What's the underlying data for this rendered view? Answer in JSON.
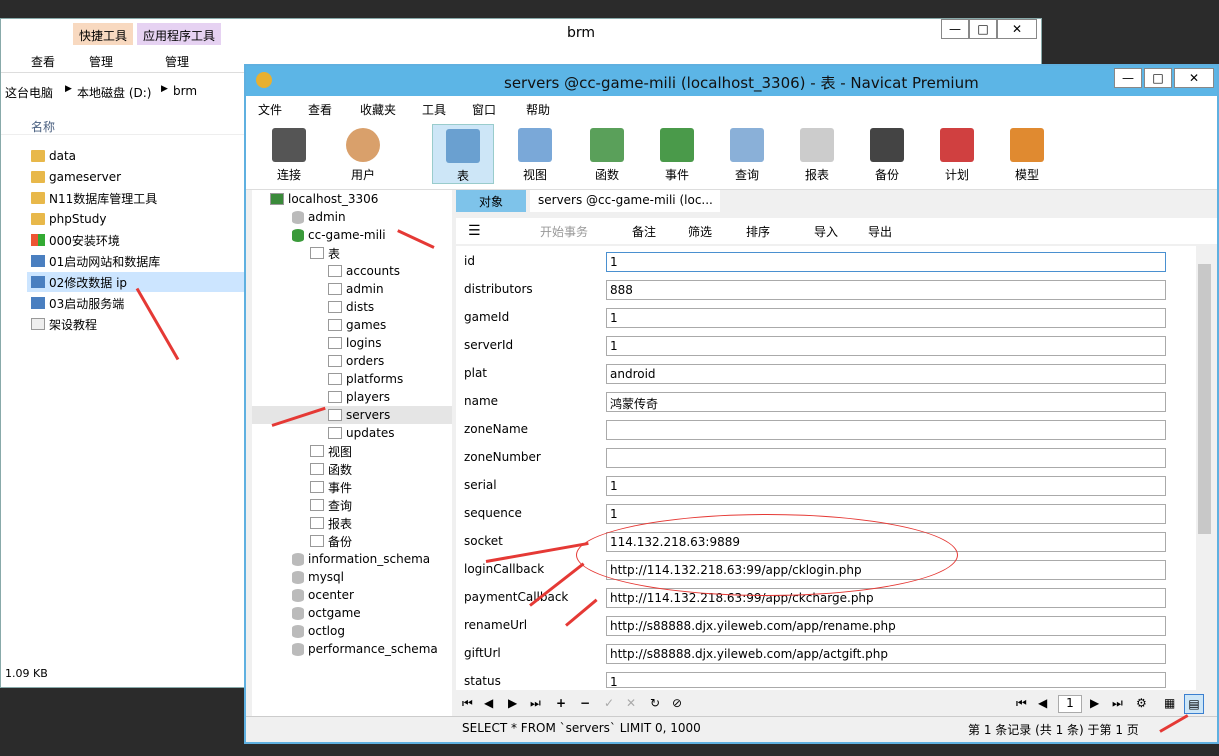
{
  "explorer": {
    "title": "brm",
    "context_tabs": [
      "快捷工具",
      "应用程序工具"
    ],
    "ribbon_tabs": [
      "查看",
      "管理",
      "管理"
    ],
    "breadcrumb": [
      "这台电脑",
      "本地磁盘 (D:)",
      "brm"
    ],
    "column_header": "名称",
    "files": [
      "data",
      "gameserver",
      "N11数据库管理工具",
      "phpStudy",
      "000安装环境",
      "01启动网站和数据库",
      "02修改数据 ip",
      "03启动服务端",
      "架设教程"
    ],
    "status": "1.09 KB"
  },
  "navicat": {
    "title": "servers @cc-game-mili (localhost_3306) - 表 - Navicat Premium",
    "menu": [
      "文件",
      "查看",
      "收藏夹",
      "工具",
      "窗口",
      "帮助"
    ],
    "tools": [
      "连接",
      "用户",
      "表",
      "视图",
      "函数",
      "事件",
      "查询",
      "报表",
      "备份",
      "计划",
      "模型"
    ],
    "tree": {
      "connection": "localhost_3306",
      "databases_top": [
        "admin",
        "cc-game-mili"
      ],
      "table_group": "表",
      "tables": [
        "accounts",
        "admin",
        "dists",
        "games",
        "logins",
        "orders",
        "platforms",
        "players",
        "servers",
        "updates"
      ],
      "groups": [
        "视图",
        "函数",
        "事件",
        "查询",
        "报表",
        "备份"
      ],
      "databases_bottom": [
        "information_schema",
        "mysql",
        "ocenter",
        "octgame",
        "octlog",
        "performance_schema"
      ]
    },
    "tabs": [
      "对象",
      "servers @cc-game-mili (loc..."
    ],
    "form_toolbar": [
      "开始事务",
      "备注",
      "筛选",
      "排序",
      "导入",
      "导出"
    ],
    "fields": [
      {
        "label": "id",
        "value": "1"
      },
      {
        "label": "distributors",
        "value": "888"
      },
      {
        "label": "gameId",
        "value": "1"
      },
      {
        "label": "serverId",
        "value": "1"
      },
      {
        "label": "plat",
        "value": "android"
      },
      {
        "label": "name",
        "value": "鸿蒙传奇"
      },
      {
        "label": "zoneName",
        "value": ""
      },
      {
        "label": "zoneNumber",
        "value": ""
      },
      {
        "label": "serial",
        "value": "1"
      },
      {
        "label": "sequence",
        "value": "1"
      },
      {
        "label": "socket",
        "value": "114.132.218.63:9889"
      },
      {
        "label": "loginCallback",
        "value": "http://114.132.218.63:99/app/cklogin.php"
      },
      {
        "label": "paymentCallback",
        "value": "http://114.132.218.63:99/app/ckcharge.php"
      },
      {
        "label": "renameUrl",
        "value": "http://s88888.djx.yileweb.com/app/rename.php"
      },
      {
        "label": "giftUrl",
        "value": "http://s88888.djx.yileweb.com/app/actgift.php"
      },
      {
        "label": "status",
        "value": "1"
      }
    ],
    "record_number": "1",
    "sql": "SELECT * FROM `servers` LIMIT 0, 1000",
    "record_status": "第 1 条记录 (共 1 条) 于第 1 页"
  }
}
